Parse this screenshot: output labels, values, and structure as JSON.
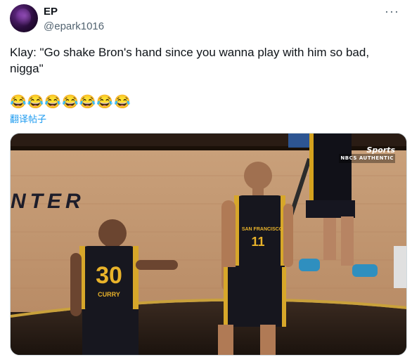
{
  "author": {
    "display_name": "EP",
    "handle": "@epark1016",
    "menu_glyph": "···"
  },
  "tweet": {
    "text": "Klay: \"Go shake Bron's hand since you wanna play with him so bad, nigga\"",
    "emojis": "😂😂😂😂😂😂😂",
    "translate_label": "翻译帖子"
  },
  "media": {
    "court_text": "NTER",
    "player_left_number": "30",
    "player_left_name": "CURRY",
    "player_right_number": "11",
    "player_right_team": "SAN FRANCISCO",
    "broadcast_logo": "Sports",
    "broadcast_sub": "NBCS AUTHENTIC"
  }
}
